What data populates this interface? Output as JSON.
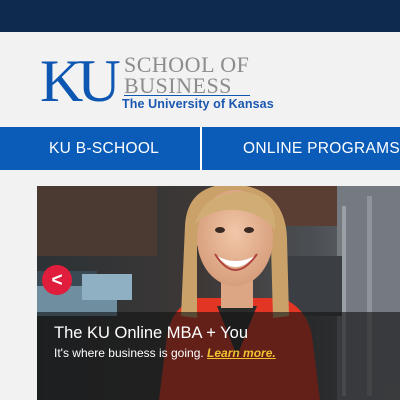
{
  "brand": {
    "logo_mark": "KU",
    "school_line1": "SCHOOL OF",
    "school_line2": "BUSINESS",
    "university": "The University of Kansas"
  },
  "nav": {
    "items": [
      {
        "label": "KU B-SCHOOL"
      },
      {
        "label": "ONLINE PROGRAMS"
      }
    ]
  },
  "hero": {
    "prev_label": "<",
    "title": "The KU Online MBA + You",
    "subtitle": "It's where business is going.",
    "link_text": "Learn more."
  },
  "colors": {
    "topbar": "#0e2a4f",
    "brand_blue": "#0b5cb8",
    "accent_red": "#e01d3c",
    "link_yellow": "#f2c230"
  }
}
